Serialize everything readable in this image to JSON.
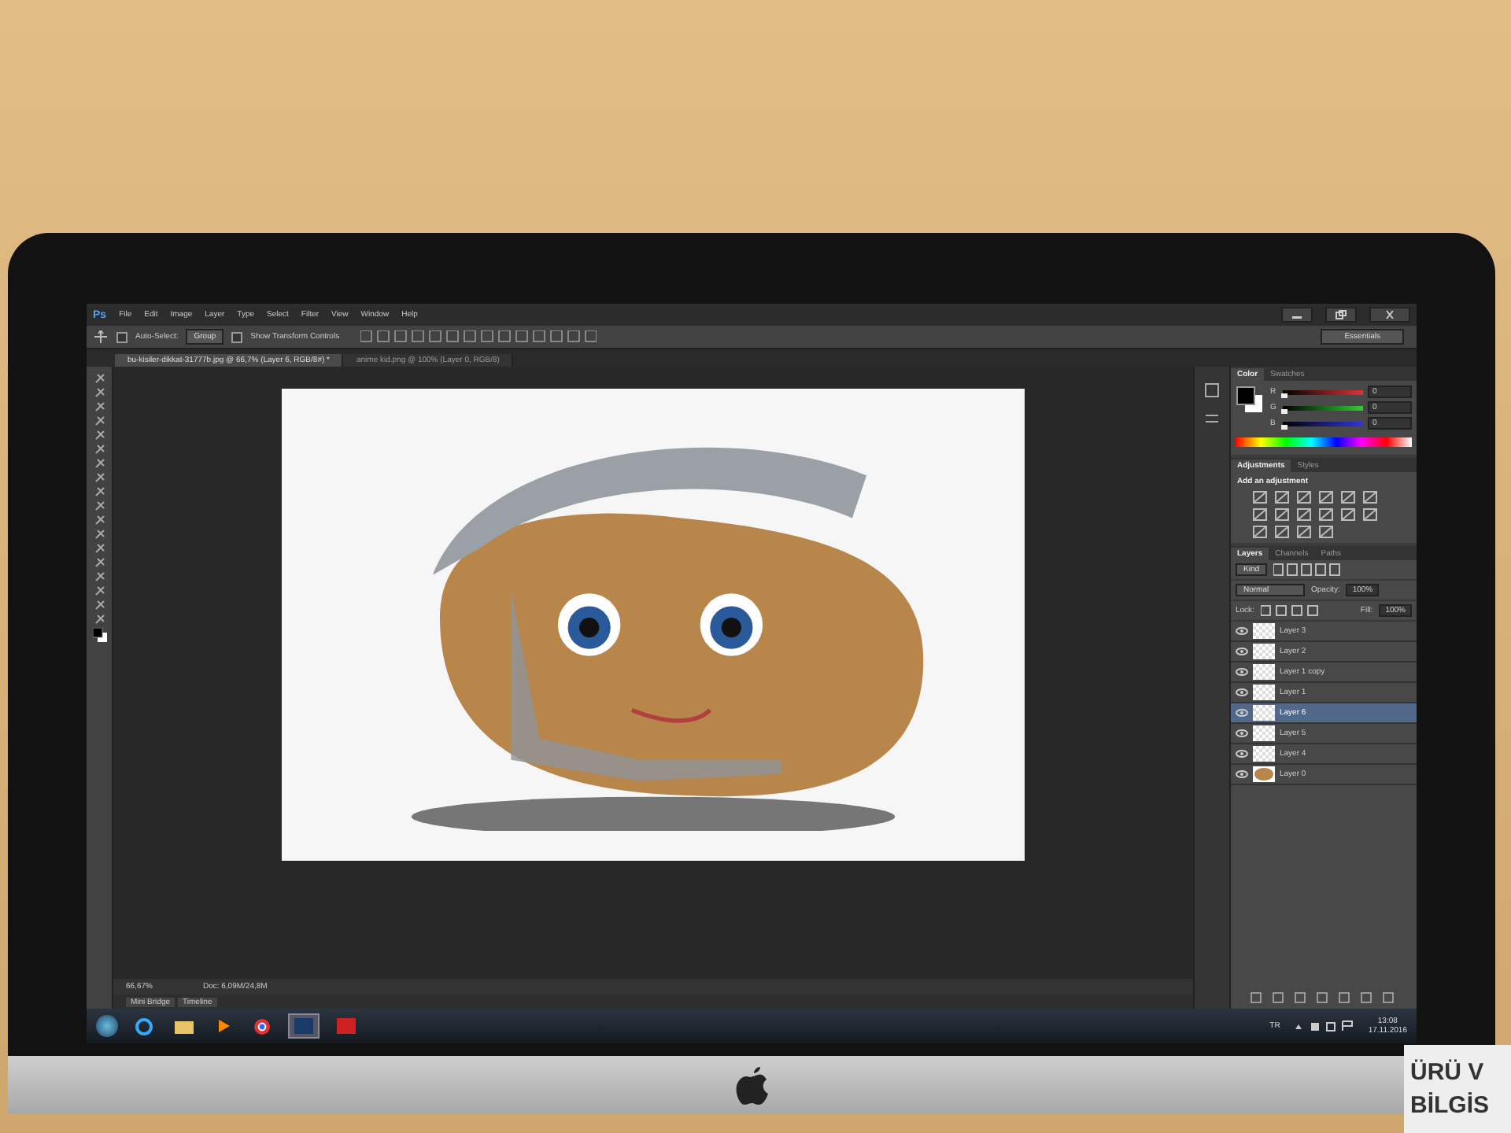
{
  "app_window": {
    "logo": "Ps",
    "menu": [
      "File",
      "Edit",
      "Image",
      "Layer",
      "Type",
      "Select",
      "Filter",
      "View",
      "Window",
      "Help"
    ],
    "workspace": "Essentials"
  },
  "options_bar": {
    "auto_select": {
      "label": "Auto-Select:",
      "checked": false
    },
    "auto_select_target": "Group",
    "transform_controls": {
      "label": "Show Transform Controls",
      "checked": false
    }
  },
  "document_tabs": [
    {
      "title": "bu-kisiler-dikkat-31777b.jpg @ 66,7% (Layer 6, RGB/8#) *",
      "selected": true
    },
    {
      "title": "anime kid.png @ 100% (Layer 0, RGB/8)",
      "selected": false
    }
  ],
  "status_bar": {
    "zoom": "66,67%",
    "doc_size": "Doc: 6,09M/24,8M",
    "tabs": [
      "Mini Bridge",
      "Timeline"
    ]
  },
  "color_panel": {
    "tabs": [
      {
        "label": "Color",
        "selected": true
      },
      {
        "label": "Swatches",
        "selected": false
      }
    ],
    "channels": [
      {
        "name": "R",
        "value": "0",
        "level": 0
      },
      {
        "name": "G",
        "value": "0",
        "level": 0
      },
      {
        "name": "B",
        "value": "0",
        "level": 0
      }
    ]
  },
  "adjustments_panel": {
    "tabs": [
      {
        "label": "Adjustments",
        "selected": true
      },
      {
        "label": "Styles",
        "selected": false
      }
    ],
    "heading": "Add an adjustment"
  },
  "layers_panel": {
    "tabs": [
      {
        "label": "Layers",
        "selected": true
      },
      {
        "label": "Channels",
        "selected": false
      },
      {
        "label": "Paths",
        "selected": false
      }
    ],
    "filter": "Kind",
    "blend_mode": "Normal",
    "opacity_label": "Opacity:",
    "opacity": "100%",
    "lock_label": "Lock:",
    "fill_label": "Fill:",
    "fill": "100%",
    "layers": [
      {
        "name": "Layer 3",
        "kind": "transparent",
        "visible": true,
        "selected": false
      },
      {
        "name": "Layer 2",
        "kind": "transparent",
        "visible": true,
        "selected": false
      },
      {
        "name": "Layer 1 copy",
        "kind": "transparent",
        "visible": true,
        "selected": false
      },
      {
        "name": "Layer 1",
        "kind": "transparent",
        "visible": true,
        "selected": false
      },
      {
        "name": "Layer 6",
        "kind": "transparent",
        "visible": true,
        "selected": true
      },
      {
        "name": "Layer 5",
        "kind": "transparent",
        "visible": true,
        "selected": false
      },
      {
        "name": "Layer 4",
        "kind": "transparent",
        "visible": true,
        "selected": false
      },
      {
        "name": "Layer 0",
        "kind": "image",
        "visible": true,
        "selected": false
      }
    ]
  },
  "taskbar": {
    "language": "TR",
    "time": "13:08",
    "date": "17.11.2016"
  },
  "sign": [
    "ÜRÜ V",
    "BİLGİS"
  ]
}
